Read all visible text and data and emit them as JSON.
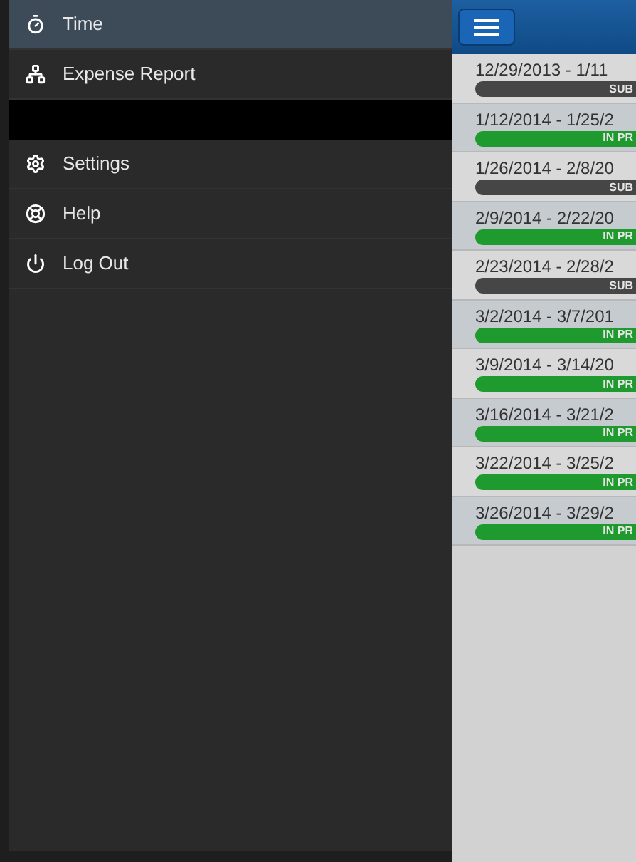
{
  "sidebar": {
    "items": [
      {
        "kind": "link",
        "label": "Time",
        "selected": true
      },
      {
        "kind": "link",
        "label": "Expense Report",
        "selected": false
      },
      {
        "kind": "spacer"
      },
      {
        "kind": "link",
        "label": "Settings",
        "selected": false
      },
      {
        "kind": "link",
        "label": "Help",
        "selected": false
      },
      {
        "kind": "link",
        "label": "Log Out",
        "selected": false
      }
    ]
  },
  "timesheets": [
    {
      "period": "12/29/2013 - 1/11",
      "status": "SUB",
      "kind": "submitted"
    },
    {
      "period": "1/12/2014 - 1/25/2",
      "status": "IN PR",
      "kind": "in_progress"
    },
    {
      "period": "1/26/2014 - 2/8/20",
      "status": "SUB",
      "kind": "submitted"
    },
    {
      "period": "2/9/2014 - 2/22/20",
      "status": "IN PR",
      "kind": "in_progress"
    },
    {
      "period": "2/23/2014 - 2/28/2",
      "status": "SUB",
      "kind": "submitted"
    },
    {
      "period": "3/2/2014 - 3/7/201",
      "status": "IN PR",
      "kind": "in_progress"
    },
    {
      "period": "3/9/2014 - 3/14/20",
      "status": "IN PR",
      "kind": "in_progress"
    },
    {
      "period": "3/16/2014 - 3/21/2",
      "status": "IN PR",
      "kind": "in_progress"
    },
    {
      "period": "3/22/2014 - 3/25/2",
      "status": "IN PR",
      "kind": "in_progress"
    },
    {
      "period": "3/26/2014 - 3/29/2",
      "status": "IN PR",
      "kind": "in_progress"
    }
  ]
}
